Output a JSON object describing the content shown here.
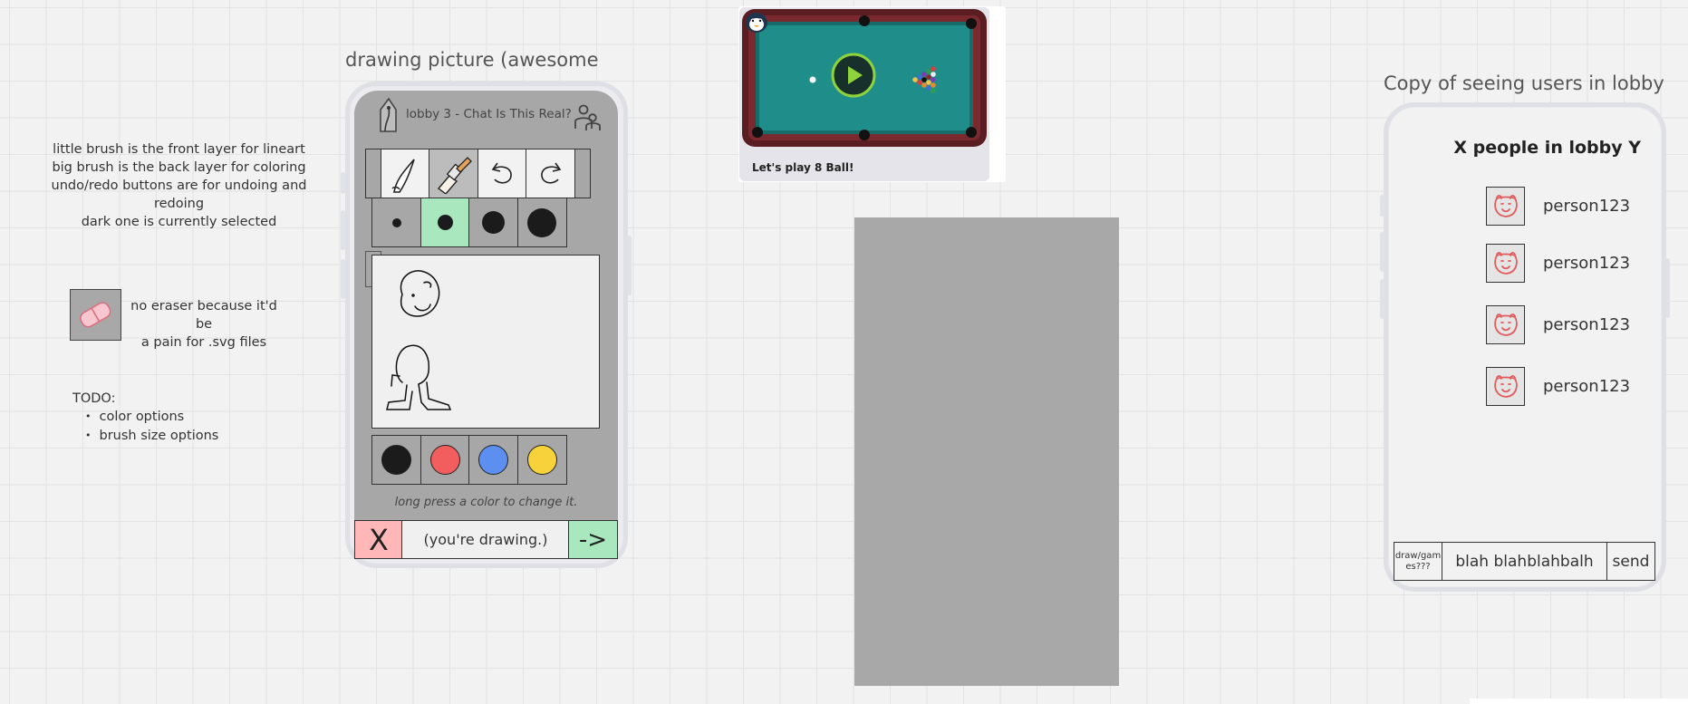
{
  "notes": {
    "brush_lines": [
      "little brush is the front layer for lineart",
      "big brush is the back layer for coloring",
      "undo/redo buttons are for undoing and redoing",
      "dark one is currently selected"
    ],
    "eraser_lines": [
      "no eraser because it'd be",
      "a pain for .svg files"
    ],
    "todo_title": "TODO:",
    "todo_items": [
      "color options",
      "brush size options"
    ]
  },
  "drawing_frame": {
    "title": "drawing picture (awesome",
    "lobby_title": "lobby 3 - Chat Is This Real?",
    "hint": "long press a color to change it.",
    "cancel_label": "X",
    "status_text": "(you're drawing.)",
    "submit_label": "->",
    "tools": [
      "little-brush-icon",
      "big-brush-icon",
      "undo-icon",
      "redo-icon"
    ],
    "brush_sizes": [
      "tiny",
      "small",
      "medium",
      "large"
    ],
    "selected_size": "small",
    "colors": [
      "#1b1b1b",
      "#f25d5d",
      "#5c8ff0",
      "#f7d23a"
    ],
    "highlight_color": "#a9e8bf"
  },
  "pool_card": {
    "caption": "Let's play 8 Ball!"
  },
  "lobby_frame": {
    "title": "Copy of seeing users in lobby",
    "heading": "X people in lobby Y",
    "people": [
      "person123",
      "person123",
      "person123",
      "person123"
    ],
    "mode_label": "draw/gam es???",
    "chat_value": "blah blahblahbalh",
    "send_label": "send"
  }
}
